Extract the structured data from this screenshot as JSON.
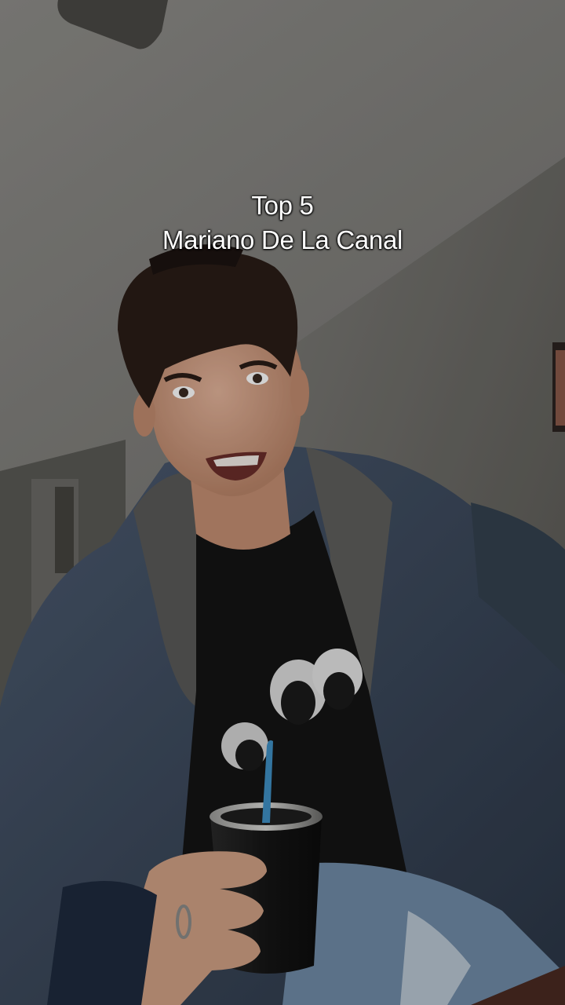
{
  "caption": {
    "line1": "Top 5",
    "line2": "Mariano De La Canal"
  },
  "colors": {
    "wall": "#6f6e6b",
    "ceiling": "#8a8986",
    "jacket": "#3c4a5e",
    "shirt": "#141414",
    "skin": "#d6a48a",
    "hair": "#2a1d17",
    "mate": "#1a1a1a",
    "straw": "#3f8fc4"
  }
}
